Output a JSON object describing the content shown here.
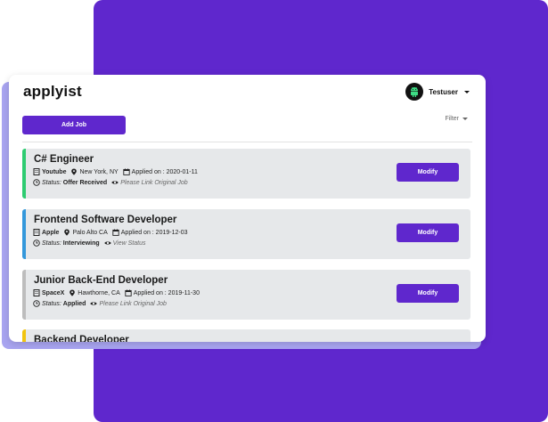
{
  "app": {
    "logo": "applyist"
  },
  "user": {
    "name": "Testuser",
    "avatar_icon": "android-icon"
  },
  "toolbar": {
    "add_job_label": "Add Job",
    "filter_label": "Filter"
  },
  "colors": {
    "brand": "#5f27cd",
    "green": "#2ecc71",
    "blue": "#3498db",
    "gray": "#bdbdbd",
    "yellow": "#f1c40f"
  },
  "jobs": [
    {
      "title": "C# Engineer",
      "company": "Youtube",
      "location": "New York, NY",
      "applied": "Applied on : 2020-01-11",
      "status_label": "Status:",
      "status": "Offer Received",
      "link_text": "Please Link Original Job",
      "modify_label": "Modify"
    },
    {
      "title": "Frontend Software Developer",
      "company": "Apple",
      "location": "Palo Alto CA",
      "applied": "Applied on : 2019-12-03",
      "status_label": "Status:",
      "status": "Interviewing",
      "link_text": "View Status",
      "modify_label": "Modify"
    },
    {
      "title": "Junior Back-End Developer",
      "company": "SpaceX",
      "location": "Hawthorne, CA",
      "applied": "Applied on : 2019-11-30",
      "status_label": "Status:",
      "status": "Applied",
      "link_text": "Please Link Original Job",
      "modify_label": "Modify"
    },
    {
      "title": "Backend Developer"
    }
  ]
}
